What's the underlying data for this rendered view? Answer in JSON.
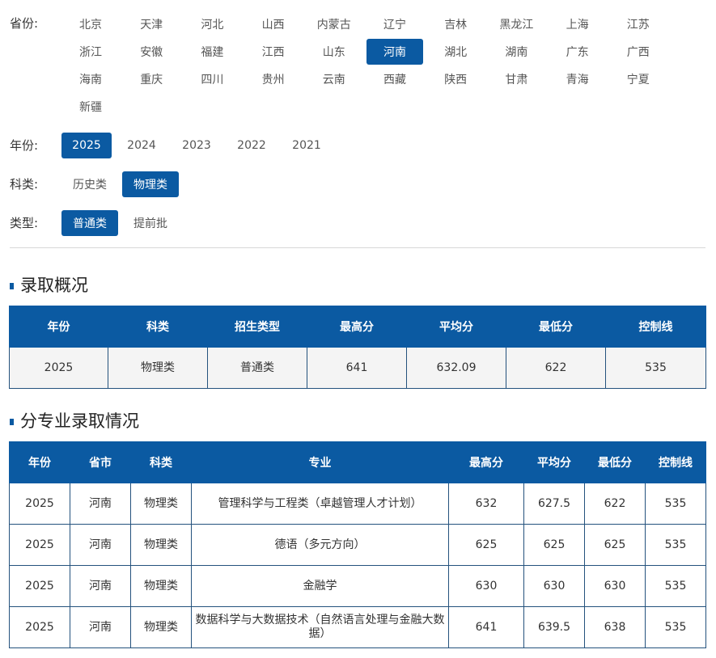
{
  "filters": {
    "province": {
      "label": "省份:",
      "options": [
        "北京",
        "天津",
        "河北",
        "山西",
        "内蒙古",
        "辽宁",
        "吉林",
        "黑龙江",
        "上海",
        "江苏",
        "浙江",
        "安徽",
        "福建",
        "江西",
        "山东",
        "河南",
        "湖北",
        "湖南",
        "广东",
        "广西",
        "海南",
        "重庆",
        "四川",
        "贵州",
        "云南",
        "西藏",
        "陕西",
        "甘肃",
        "青海",
        "宁夏",
        "新疆"
      ],
      "selected": "河南"
    },
    "year": {
      "label": "年份:",
      "options": [
        "2025",
        "2024",
        "2023",
        "2022",
        "2021"
      ],
      "selected": "2025"
    },
    "subject": {
      "label": "科类:",
      "options": [
        "历史类",
        "物理类"
      ],
      "selected": "物理类"
    },
    "type": {
      "label": "类型:",
      "options": [
        "普通类",
        "提前批"
      ],
      "selected": "普通类"
    }
  },
  "colors": {
    "accent": "#0b5aa2"
  },
  "overview": {
    "title": "录取概况",
    "headers": [
      "年份",
      "科类",
      "招生类型",
      "最高分",
      "平均分",
      "最低分",
      "控制线"
    ],
    "rows": [
      [
        "2025",
        "物理类",
        "普通类",
        "641",
        "632.09",
        "622",
        "535"
      ]
    ]
  },
  "majors": {
    "title": "分专业录取情况",
    "headers": [
      "年份",
      "省市",
      "科类",
      "专业",
      "最高分",
      "平均分",
      "最低分",
      "控制线"
    ],
    "rows": [
      [
        "2025",
        "河南",
        "物理类",
        "管理科学与工程类（卓越管理人才计划）",
        "632",
        "627.5",
        "622",
        "535"
      ],
      [
        "2025",
        "河南",
        "物理类",
        "德语（多元方向）",
        "625",
        "625",
        "625",
        "535"
      ],
      [
        "2025",
        "河南",
        "物理类",
        "金融学",
        "630",
        "630",
        "630",
        "535"
      ],
      [
        "2025",
        "河南",
        "物理类",
        "数据科学与大数据技术（自然语言处理与金融大数据）",
        "641",
        "639.5",
        "638",
        "535"
      ]
    ]
  }
}
